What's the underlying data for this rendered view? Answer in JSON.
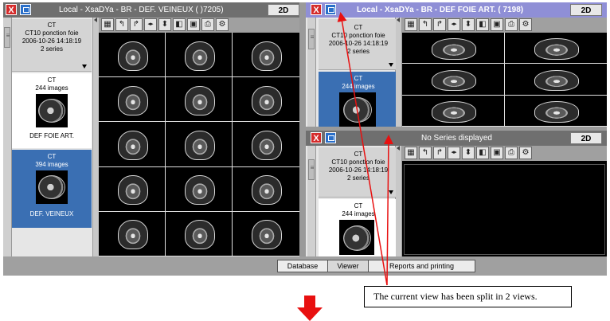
{
  "colors": {
    "accent_red": "#e81010",
    "selected": "#3a6fb3",
    "active_title": "#8f8fd6"
  },
  "left_window": {
    "title": "Local - XsaDYa - BR        - DEF. VEINEUX (  )7205)",
    "mode_button": "2D",
    "study": {
      "modality": "CT",
      "description": "CT10 ponction foie",
      "date": "2006-10-26 14:18:19",
      "series_count": "2 series"
    },
    "series": [
      {
        "modality": "CT",
        "images": "244 images",
        "name": "DEF FOIE ART.",
        "selected": false
      },
      {
        "modality": "CT",
        "images": "394 images",
        "name": "DEF. VEINEUX",
        "selected": true
      }
    ]
  },
  "right_top_window": {
    "title": "Local - XsaDYa - BR       - DEF FOIE ART. (    7198)",
    "mode_button": "2D",
    "study": {
      "modality": "CT",
      "description": "CT10 ponction foie",
      "date": "2006-10-26 14:18:19",
      "series_count": "2 series"
    },
    "series": [
      {
        "modality": "CT",
        "images": "244 images",
        "selected": true
      }
    ]
  },
  "right_bottom_window": {
    "title": "No Series displayed",
    "mode_button": "2D",
    "study": {
      "modality": "CT",
      "description": "CT10 ponction foie",
      "date": "2006-10-26 14:18:19",
      "series_count": "2 series"
    },
    "series": [
      {
        "modality": "CT",
        "images": "244 images",
        "selected": false
      }
    ]
  },
  "toolbar_icons": [
    "layout-grid-icon",
    "rotate-left-icon",
    "rotate-right-icon",
    "flip-horizontal-icon",
    "flip-vertical-icon",
    "invert-icon",
    "crop-icon",
    "print-icon",
    "gear-icon"
  ],
  "bottom_tabs": [
    {
      "label": "Database",
      "active": false
    },
    {
      "label": "Viewer",
      "active": true
    },
    {
      "label": "Reports and printing",
      "active": false
    }
  ],
  "close_glyph": "X",
  "callout": "The current view has been split in 2 views."
}
